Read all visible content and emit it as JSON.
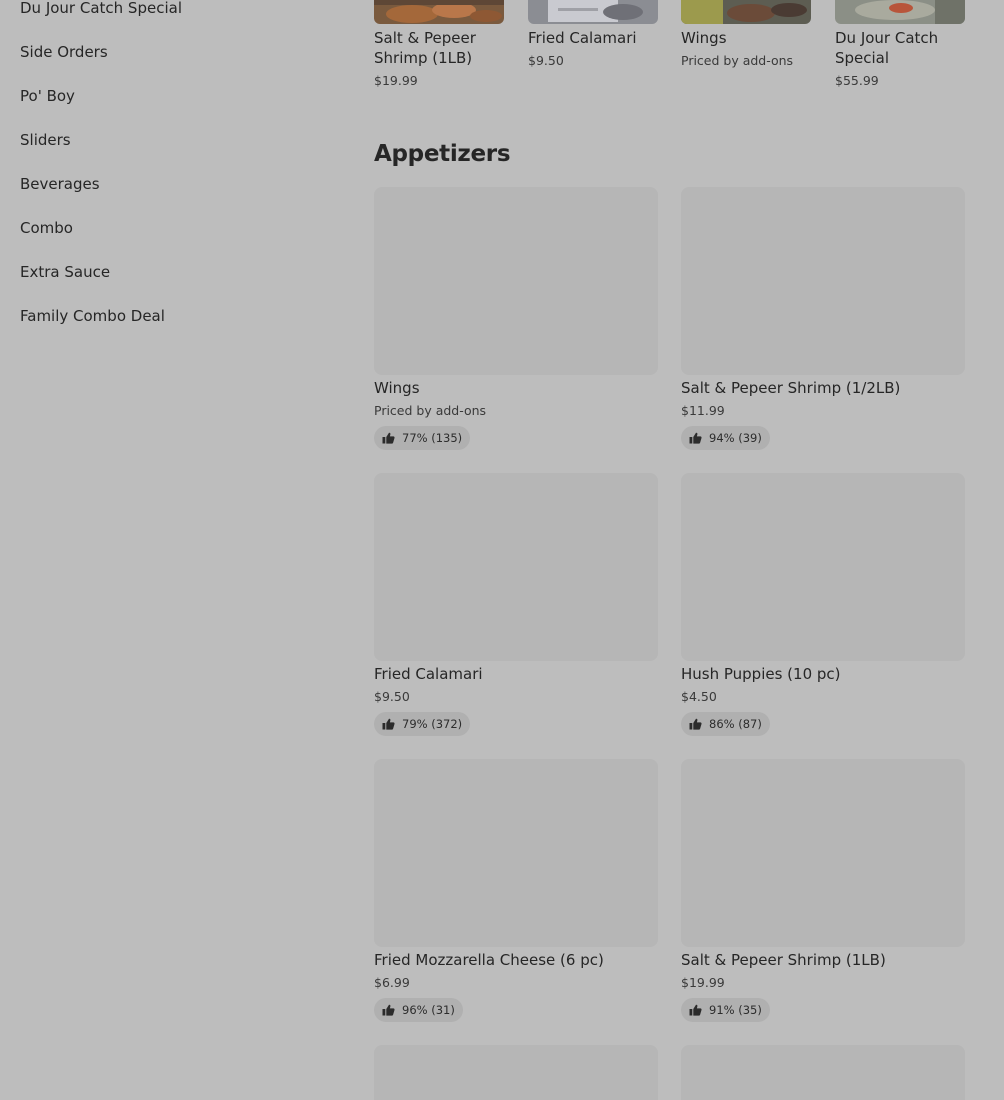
{
  "sidebar": {
    "items": [
      {
        "label": "Du Jour Catch Special"
      },
      {
        "label": "Side Orders"
      },
      {
        "label": "Po' Boy"
      },
      {
        "label": "Sliders"
      },
      {
        "label": "Beverages"
      },
      {
        "label": "Combo"
      },
      {
        "label": "Extra Sauce"
      },
      {
        "label": "Family Combo Deal"
      }
    ]
  },
  "featured": {
    "items": [
      {
        "name": "Salt & Pepeer Shrimp (1LB)",
        "price": "$19.99"
      },
      {
        "name": "Fried Calamari",
        "price": "$9.50"
      },
      {
        "name": "Wings",
        "price": "Priced by add-ons"
      },
      {
        "name": "Du Jour Catch Special",
        "price": "$55.99"
      }
    ]
  },
  "appetizers": {
    "title": "Appetizers",
    "items": [
      {
        "name": "Wings",
        "price": "Priced by add-ons",
        "rating": "77% (135)"
      },
      {
        "name": "Salt & Pepeer Shrimp (1/2LB)",
        "price": "$11.99",
        "rating": "94% (39)"
      },
      {
        "name": "Fried Calamari",
        "price": "$9.50",
        "rating": "79% (372)"
      },
      {
        "name": "Hush Puppies (10 pc)",
        "price": "$4.50",
        "rating": "86% (87)"
      },
      {
        "name": "Fried Mozzarella Cheese (6 pc)",
        "price": "$6.99",
        "rating": "96% (31)"
      },
      {
        "name": "Salt & Pepeer Shrimp (1LB)",
        "price": "$19.99",
        "rating": "91% (35)"
      }
    ]
  },
  "icons": {
    "rating": "thumbs-up-icon"
  }
}
